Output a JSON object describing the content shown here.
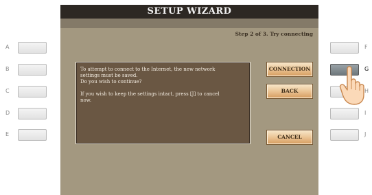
{
  "screen": {
    "title": "SETUP WIZARD",
    "step_text": "Step 2 of 3. Try connecting",
    "message": {
      "line1": "To attempt to connect to the Internet, the new network",
      "line2": "settings must be saved.",
      "line3": "Do you wish to continue?",
      "line4": "If you wish to keep the settings intact, press [J] to cancel",
      "line5": "now."
    },
    "buttons": {
      "connection": "CONNECTION",
      "back": "BACK",
      "cancel": "CANCEL"
    }
  },
  "panel": {
    "left_letters": [
      "A",
      "B",
      "C",
      "D",
      "E"
    ],
    "right_letters": [
      "F",
      "G",
      "H",
      "I",
      "J"
    ],
    "pressed_button": "G"
  },
  "colors": {
    "screen_bg": "#a39880",
    "title_bar": "#2d2823",
    "message_bg": "#6a5743",
    "button_orange": "#e9c190"
  },
  "icons": [
    "pointing-hand-icon"
  ]
}
